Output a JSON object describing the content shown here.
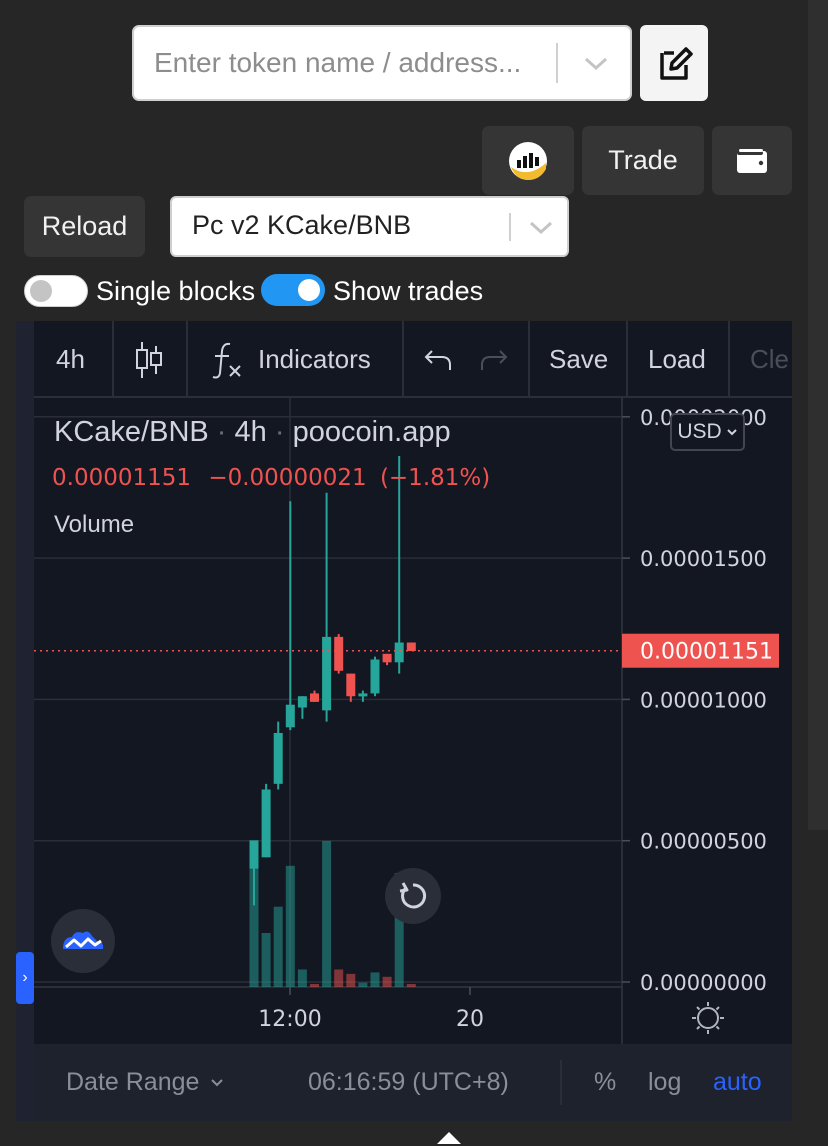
{
  "search": {
    "placeholder": "Enter token name / address..."
  },
  "buttons": {
    "trade": "Trade",
    "reload": "Reload"
  },
  "pair_select": {
    "value": "Pc v2 KCake/BNB"
  },
  "toggles": {
    "single_blocks": {
      "label": "Single blocks",
      "on": false
    },
    "show_trades": {
      "label": "Show trades",
      "on": true
    }
  },
  "toolbar": {
    "interval": "4h",
    "indicators": "Indicators",
    "save": "Save",
    "load": "Load",
    "clear": "Cle"
  },
  "legend": {
    "pair": "KCake/BNB",
    "interval": "4h",
    "source": "poocoin.app",
    "close": "0.00001151",
    "change": "−0.00000021",
    "change_pct": "(−1.81%)",
    "volume_label": "Volume"
  },
  "currency": "USD",
  "price_axis": {
    "ticks": [
      "0.00002000",
      "0.00001500",
      "0.00001000",
      "0.00000500",
      "0.00000000"
    ],
    "current_price_label": "0.00001151"
  },
  "time_axis": {
    "ticks": [
      "12:00",
      "20"
    ]
  },
  "footer": {
    "date_range": "Date Range",
    "time": "06:16:59 (UTC+8)",
    "percent": "%",
    "log": "log",
    "auto": "auto"
  },
  "colors": {
    "up": "#26a69a",
    "down": "#ef5350",
    "accent": "#2962ff",
    "toggle_on": "#2196f3"
  },
  "chart_data": {
    "type": "candlestick",
    "title": "KCake/BNB · 4h · poocoin.app",
    "ylim": [
      0,
      2e-05
    ],
    "y_ticks": [
      2e-05,
      1.5e-05,
      1e-05,
      5e-06,
      0
    ],
    "x_ticks": [
      "12:00",
      "20"
    ],
    "current_price": 1.151e-05,
    "candles": [
      {
        "open": 3.8e-06,
        "high": 4.4e-06,
        "low": 2.5e-06,
        "close": 4.8e-06,
        "up": true
      },
      {
        "open": 4.2e-06,
        "high": 6.8e-06,
        "low": 4.2e-06,
        "close": 6.6e-06,
        "up": true
      },
      {
        "open": 6.8e-06,
        "high": 9e-06,
        "low": 6.6e-06,
        "close": 8.6e-06,
        "up": true
      },
      {
        "open": 8.8e-06,
        "high": 1.68e-05,
        "low": 8.7e-06,
        "close": 9.6e-06,
        "up": true
      },
      {
        "open": 9.5e-06,
        "high": 9.9e-06,
        "low": 9.1e-06,
        "close": 9.9e-06,
        "up": true
      },
      {
        "open": 1e-05,
        "high": 1.01e-05,
        "low": 9.7e-06,
        "close": 9.7e-06,
        "up": false
      },
      {
        "open": 9.4e-06,
        "high": 1.71e-05,
        "low": 9e-06,
        "close": 1.2e-05,
        "up": true
      },
      {
        "open": 1.2e-05,
        "high": 1.21e-05,
        "low": 1.07e-05,
        "close": 1.08e-05,
        "up": false
      },
      {
        "open": 1.07e-05,
        "high": 1.07e-05,
        "low": 9.7e-06,
        "close": 9.9e-06,
        "up": false
      },
      {
        "open": 1e-05,
        "high": 1.01e-05,
        "low": 9.7e-06,
        "close": 1e-05,
        "up": true
      },
      {
        "open": 1e-05,
        "high": 1.13e-05,
        "low": 9.9e-06,
        "close": 1.12e-05,
        "up": true
      },
      {
        "open": 1.14e-05,
        "high": 1.14e-05,
        "low": 1.1e-05,
        "close": 1.11e-05,
        "up": false
      },
      {
        "open": 1.11e-05,
        "high": 1.84e-05,
        "low": 1.07e-05,
        "close": 1.18e-05,
        "up": true
      },
      {
        "open": 1.18e-05,
        "high": 1.18e-05,
        "low": 1.15e-05,
        "close": 1.15e-05,
        "up": false
      }
    ],
    "volume": [
      {
        "v": 0.87,
        "up": true
      },
      {
        "v": 0.37,
        "up": true
      },
      {
        "v": 0.55,
        "up": true
      },
      {
        "v": 0.83,
        "up": true
      },
      {
        "v": 0.12,
        "up": true
      },
      {
        "v": 0.01,
        "up": false
      },
      {
        "v": 1.0,
        "up": true
      },
      {
        "v": 0.12,
        "up": false
      },
      {
        "v": 0.09,
        "up": false
      },
      {
        "v": 0.03,
        "up": true
      },
      {
        "v": 0.1,
        "up": true
      },
      {
        "v": 0.07,
        "up": false
      },
      {
        "v": 0.78,
        "up": true
      },
      {
        "v": 0.01,
        "up": false
      }
    ]
  }
}
